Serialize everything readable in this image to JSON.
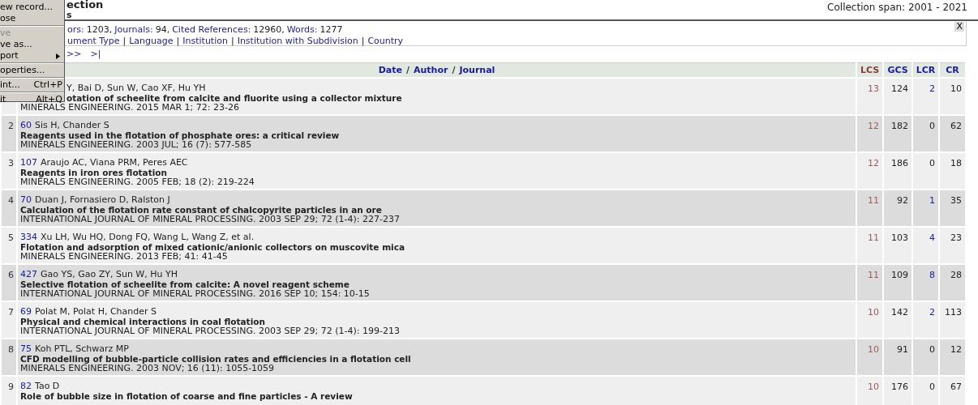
{
  "header": {
    "title": "ection",
    "subtitle": "s",
    "span": "Collection span: 2001 - 2021"
  },
  "info": {
    "stats": [
      {
        "label": "ors:",
        "value": "1203,"
      },
      {
        "label": "Journals:",
        "value": "94,"
      },
      {
        "label": "Cited References:",
        "value": "12960,"
      },
      {
        "label": "Words:",
        "value": "1277"
      }
    ],
    "links": [
      "ument Type",
      "Language",
      "Institution",
      "Institution with Subdivision",
      "Country"
    ],
    "link_separator": "|",
    "close": "X"
  },
  "pager": [
    ">>",
    ">|"
  ],
  "menu": [
    {
      "kind": "item",
      "label": "ew record...",
      "disabled": false
    },
    {
      "kind": "item",
      "label": "ose",
      "disabled": false
    },
    {
      "kind": "separator"
    },
    {
      "kind": "item",
      "label": "ve",
      "disabled": true
    },
    {
      "kind": "item",
      "label": "ve as...",
      "disabled": false
    },
    {
      "kind": "submenu",
      "label": "port",
      "disabled": false
    },
    {
      "kind": "separator"
    },
    {
      "kind": "item",
      "label": "operties...",
      "disabled": false
    },
    {
      "kind": "separator"
    },
    {
      "kind": "item",
      "label": "int...",
      "shortcut": "Ctrl+P",
      "disabled": false
    },
    {
      "kind": "separator"
    },
    {
      "kind": "item",
      "label": "it",
      "shortcut": "Alt+Q",
      "disabled": false
    }
  ],
  "table": {
    "sort_links": [
      "Date",
      "Author",
      "Journal"
    ],
    "sort_sep": "/",
    "columns": [
      {
        "label": "LCS",
        "kind": "lcs"
      },
      {
        "label": "GCS",
        "kind": "link"
      },
      {
        "label": "LCR",
        "kind": "link"
      },
      {
        "label": "CR",
        "kind": "link"
      }
    ],
    "rows": [
      {
        "authors": "Y, Bai D, Sun W, Cao XF, Hu YH",
        "title": "otation of scheelite from calcite and fluorite using a collector mixture",
        "source": "MINERALS ENGINEERING. 2015 MAR 1; 72: 23-26",
        "lcs": "13",
        "gcs": "124",
        "lcr": "2",
        "lcr_linked": true,
        "cr": "10"
      },
      {
        "number": "2",
        "id": "60",
        "authors": "Sis H, Chander S",
        "title": "Reagents used in the flotation of phosphate ores: a critical review",
        "source": "MINERALS ENGINEERING. 2003 JUL; 16 (7): 577-585",
        "lcs": "12",
        "gcs": "182",
        "lcr": "0",
        "lcr_linked": false,
        "cr": "62"
      },
      {
        "number": "3",
        "id": "107",
        "authors": "Araujo AC, Viana PRM, Peres AEC",
        "title": "Reagents in iron ores flotation",
        "source": "MINERALS ENGINEERING. 2005 FEB; 18 (2): 219-224",
        "lcs": "12",
        "gcs": "186",
        "lcr": "0",
        "lcr_linked": false,
        "cr": "18"
      },
      {
        "number": "4",
        "id": "70",
        "authors": "Duan J, Fornasiero D, Ralston J",
        "title": "Calculation of the flotation rate constant of chalcopyrite particles in an ore",
        "source": "INTERNATIONAL JOURNAL OF MINERAL PROCESSING. 2003 SEP 29; 72 (1-4): 227-237",
        "lcs": "11",
        "gcs": "92",
        "lcr": "1",
        "lcr_linked": true,
        "cr": "35"
      },
      {
        "number": "5",
        "id": "334",
        "authors": "Xu LH, Wu HQ, Dong FQ, Wang L, Wang Z, et al.",
        "title": "Flotation and adsorption of mixed cationic/anionic collectors on muscovite mica",
        "source": "MINERALS ENGINEERING. 2013 FEB; 41: 41-45",
        "lcs": "11",
        "gcs": "103",
        "lcr": "4",
        "lcr_linked": true,
        "cr": "23"
      },
      {
        "number": "6",
        "id": "427",
        "authors": "Gao YS, Gao ZY, Sun W, Hu YH",
        "title": "Selective flotation of scheelite from calcite: A novel reagent scheme",
        "source": "INTERNATIONAL JOURNAL OF MINERAL PROCESSING. 2016 SEP 10; 154: 10-15",
        "lcs": "11",
        "gcs": "109",
        "lcr": "8",
        "lcr_linked": true,
        "cr": "28"
      },
      {
        "number": "7",
        "id": "69",
        "authors": "Polat M, Polat H, Chander S",
        "title": "Physical and chemical interactions in coal flotation",
        "source": "INTERNATIONAL JOURNAL OF MINERAL PROCESSING. 2003 SEP 29; 72 (1-4): 199-213",
        "lcs": "10",
        "gcs": "142",
        "lcr": "2",
        "lcr_linked": true,
        "cr": "113"
      },
      {
        "number": "8",
        "id": "75",
        "authors": "Koh PTL, Schwarz MP",
        "title": "CFD modelling of bubble-particle collision rates and efficiencies in a flotation cell",
        "source": "MINERALS ENGINEERING. 2003 NOV; 16 (11): 1055-1059",
        "lcs": "10",
        "gcs": "91",
        "lcr": "0",
        "lcr_linked": false,
        "cr": "12"
      },
      {
        "number": "9",
        "id": "82",
        "authors": "Tao D",
        "title": "Role of bubble size in flotation of coarse and fine particles - A review",
        "lcs": "10",
        "gcs": "176",
        "lcr": "0",
        "lcr_linked": false,
        "cr": "67"
      }
    ]
  }
}
